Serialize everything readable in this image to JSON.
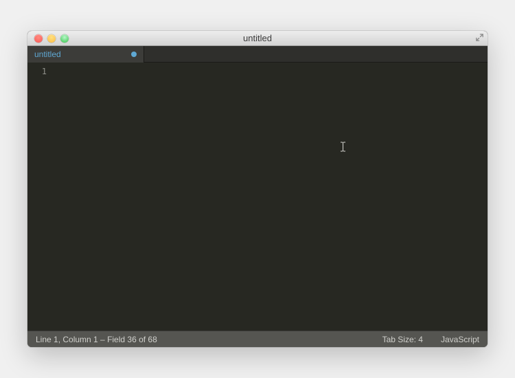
{
  "window": {
    "title": "untitled"
  },
  "tabs": [
    {
      "label": "untitled",
      "dirty": true
    }
  ],
  "editor": {
    "line_numbers": [
      "1"
    ]
  },
  "statusbar": {
    "position": "Line 1, Column 1 – Field 36 of 68",
    "tab_size": "Tab Size: 4",
    "syntax": "JavaScript"
  }
}
